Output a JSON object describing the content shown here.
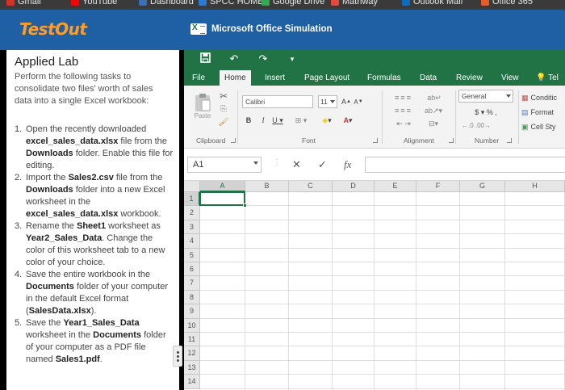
{
  "bookmarks": [
    {
      "label": "Gmail",
      "color": "#d93025"
    },
    {
      "label": "YouTube",
      "color": "#ff0000"
    },
    {
      "label": "Dashboard",
      "color": "#3b6fb6"
    },
    {
      "label": "SPCC HOME",
      "color": "#2a7bd3"
    },
    {
      "label": "Google Drive",
      "color": "#34a853"
    },
    {
      "label": "Mathway",
      "color": "#e4493d"
    },
    {
      "label": "Outlook Mail",
      "color": "#0f6cbd"
    },
    {
      "label": "Office 365",
      "color": "#e85c27"
    }
  ],
  "header": {
    "logo": "TestOut",
    "sim_title": "Microsoft Office Simulation"
  },
  "lab": {
    "title": "Applied Lab",
    "intro": "Perform the following tasks to consolidate two files' worth of sales data into a single Excel workbook:",
    "steps": [
      {
        "num": "1.",
        "parts": [
          {
            "t": "Open the recently downloaded ",
            "b": false
          },
          {
            "t": "excel_sales_data.xlsx",
            "b": true
          },
          {
            "t": " file from the ",
            "b": false
          },
          {
            "t": "Downloads",
            "b": true
          },
          {
            "t": " folder. Enable this file for editing.",
            "b": false
          }
        ]
      },
      {
        "num": "2.",
        "parts": [
          {
            "t": "Import the ",
            "b": false
          },
          {
            "t": "Sales2.csv",
            "b": true
          },
          {
            "t": " file from the ",
            "b": false
          },
          {
            "t": "Downloads",
            "b": true
          },
          {
            "t": " folder into a new Excel worksheet in the ",
            "b": false
          },
          {
            "t": "excel_sales_data.xlsx",
            "b": true
          },
          {
            "t": " workbook.",
            "b": false
          }
        ]
      },
      {
        "num": "3.",
        "parts": [
          {
            "t": "Rename the ",
            "b": false
          },
          {
            "t": "Sheet1",
            "b": true
          },
          {
            "t": " worksheet as ",
            "b": false
          },
          {
            "t": "Year2_Sales_Data",
            "b": true
          },
          {
            "t": ". Change the color of this worksheet tab to a new color of your choice.",
            "b": false
          }
        ]
      },
      {
        "num": "4.",
        "parts": [
          {
            "t": "Save the entire workbook in the ",
            "b": false
          },
          {
            "t": "Documents",
            "b": true
          },
          {
            "t": " folder of your computer in the default Excel format (",
            "b": false
          },
          {
            "t": "SalesData.xlsx",
            "b": true
          },
          {
            "t": ").",
            "b": false
          }
        ]
      },
      {
        "num": "5.",
        "parts": [
          {
            "t": "Save the ",
            "b": false
          },
          {
            "t": "Year1_Sales_Data",
            "b": true
          },
          {
            "t": " worksheet in the ",
            "b": false
          },
          {
            "t": "Documents",
            "b": true
          },
          {
            "t": " folder of your computer as a PDF file named ",
            "b": false
          },
          {
            "t": "Sales1.pdf",
            "b": true
          },
          {
            "t": ".",
            "b": false
          }
        ]
      }
    ]
  },
  "excel": {
    "accent": "#217346",
    "tabs": [
      "File",
      "Home",
      "Insert",
      "Page Layout",
      "Formulas",
      "Data",
      "Review",
      "View"
    ],
    "active_tab": "Home",
    "tell_me": "Tel",
    "ribbon": {
      "paste_label": "Paste",
      "clipboard_label": "Clipboard",
      "font_name": "Calibri",
      "font_size": "11",
      "font_label": "Font",
      "alignment_label": "Alignment",
      "number_format": "General",
      "number_label": "Number",
      "styles": [
        "Conditic",
        "Format",
        "Cell Sty"
      ]
    },
    "name_box": "A1",
    "columns": [
      "A",
      "B",
      "C",
      "D",
      "E",
      "F",
      "G",
      "H"
    ],
    "rows": [
      "1",
      "2",
      "3",
      "4",
      "5",
      "6",
      "7",
      "8",
      "9",
      "10",
      "11",
      "12",
      "13",
      "14"
    ],
    "active_cell": "A1"
  }
}
